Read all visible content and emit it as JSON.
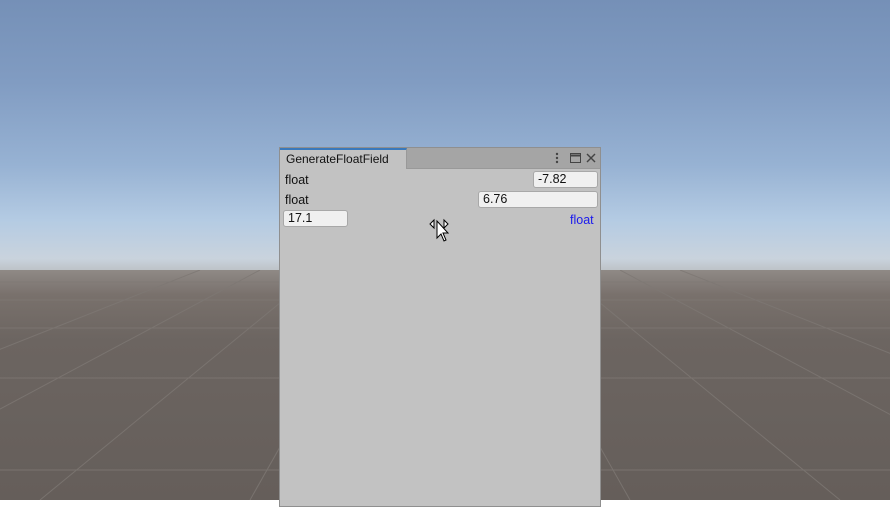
{
  "window": {
    "tab_title": "GenerateFloatField",
    "icons": [
      "more-options-icon",
      "maximize-icon",
      "close-icon"
    ]
  },
  "rows": [
    {
      "label": "float",
      "value": "-7.82"
    },
    {
      "label": "float",
      "value": "6.76"
    },
    {
      "label": "float",
      "value": "17.1",
      "label_color": "#1a1aee"
    }
  ],
  "cursor": {
    "icon": "resize-horizontal-cursor-icon"
  }
}
